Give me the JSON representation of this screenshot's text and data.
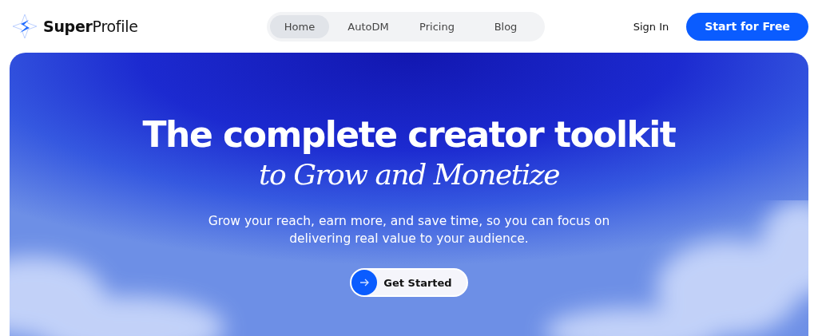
{
  "brand": {
    "name": "**Super**Profile"
  },
  "nav": [
    {
      "label": "Home",
      "selected": true
    },
    {
      "label": "AutoDM",
      "selected": false
    },
    {
      "label": "Pricing",
      "selected": false
    },
    {
      "label": "Blog",
      "selected": false
    }
  ],
  "sign_in": "Sign In",
  "cta": "Start for Free",
  "hero": {
    "title": "The complete creator toolkit",
    "subtitle": "to Grow and Monetize",
    "description": "Grow your reach, earn more, and save time, so you can focus on delivering real value to your audience.",
    "button": "Get Started"
  }
}
